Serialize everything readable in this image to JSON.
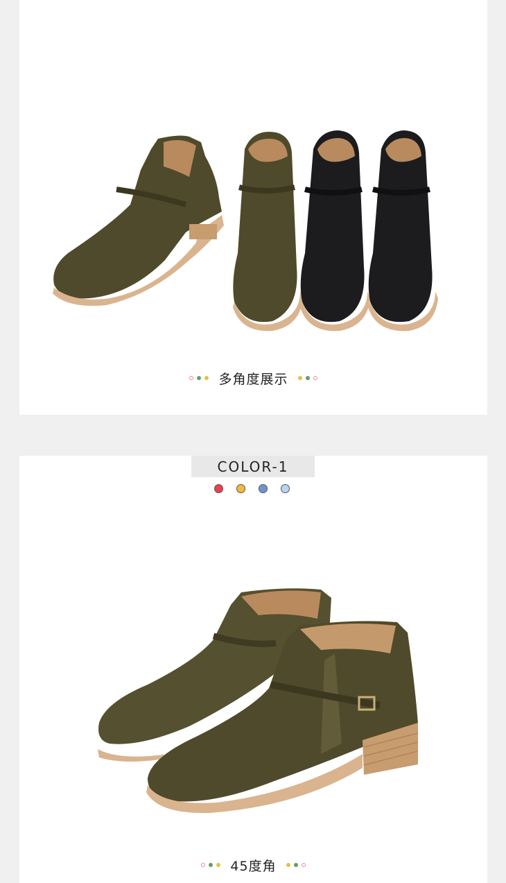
{
  "section_multi_angle": {
    "caption": "多角度展示",
    "dots_left": [
      "#e88a9a",
      "#6a9a6a",
      "#e5c04a"
    ],
    "dots_right": [
      "#e5c04a",
      "#6a9a6a",
      "#e88a9a"
    ]
  },
  "section_color": {
    "tab_label": "COLOR-1",
    "swatch_colors": [
      "#e84150",
      "#f2b93e",
      "#6f95cf",
      "#b9d3f0"
    ],
    "caption": "45度角",
    "dots_left": [
      "#e88a9a",
      "#6a9a6a",
      "#e5c04a"
    ],
    "dots_right": [
      "#e5c04a",
      "#6a9a6a",
      "#e88a9a"
    ]
  },
  "product_colors": {
    "olive_suede": "#4f4a2b",
    "black_suede": "#1c1c1e",
    "sole": "#d9b48e",
    "lining": "#b98a5e"
  }
}
